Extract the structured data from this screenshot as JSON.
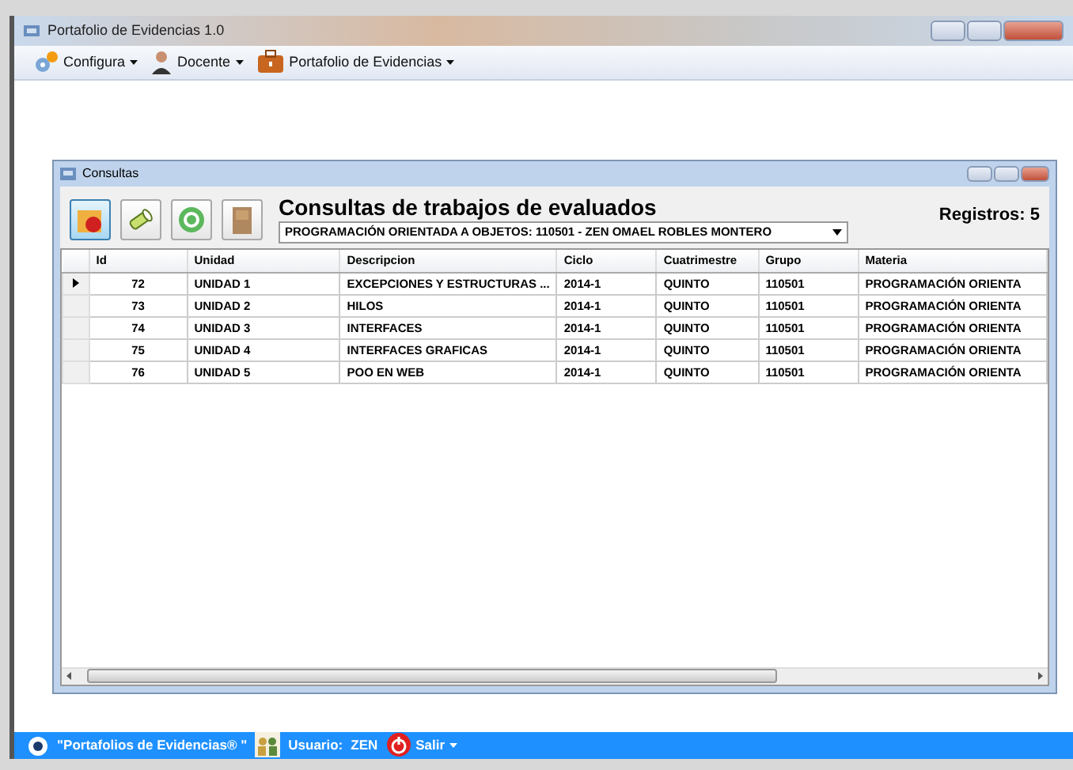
{
  "window": {
    "title": "Portafolio de Evidencias 1.0"
  },
  "menu": [
    {
      "label": "Configura"
    },
    {
      "label": "Docente"
    },
    {
      "label": "Portafolio de Evidencias"
    }
  ],
  "child_window": {
    "title": "Consultas",
    "heading": "Consultas de trabajos de evaluados",
    "records": "Registros: 5",
    "selector": {
      "value": "PROGRAMACIÓN ORIENTADA A OBJETOS: 110501 - ZEN OMAEL ROBLES MONTERO"
    }
  },
  "table": {
    "columns": [
      "Id",
      "Unidad",
      "Descripcion",
      "Ciclo",
      "Cuatrimestre",
      "Grupo",
      "Materia"
    ],
    "rows": [
      {
        "selected": true,
        "cells": [
          "72",
          "UNIDAD 1",
          "EXCEPCIONES Y ESTRUCTURAS ...",
          "2014-1",
          "QUINTO",
          "110501",
          "PROGRAMACIÓN ORIENTA"
        ]
      },
      {
        "selected": false,
        "cells": [
          "73",
          "UNIDAD 2",
          "HILOS",
          "2014-1",
          "QUINTO",
          "110501",
          "PROGRAMACIÓN ORIENTA"
        ]
      },
      {
        "selected": false,
        "cells": [
          "74",
          "UNIDAD 3",
          "INTERFACES",
          "2014-1",
          "QUINTO",
          "110501",
          "PROGRAMACIÓN ORIENTA"
        ]
      },
      {
        "selected": false,
        "cells": [
          "75",
          "UNIDAD 4",
          "INTERFACES GRAFICAS",
          "2014-1",
          "QUINTO",
          "110501",
          "PROGRAMACIÓN ORIENTA"
        ]
      },
      {
        "selected": false,
        "cells": [
          "76",
          "UNIDAD 5",
          "POO EN WEB",
          "2014-1",
          "QUINTO",
          "110501",
          "PROGRAMACIÓN ORIENTA"
        ]
      }
    ]
  },
  "status_bar": {
    "app": "\"Portafolios de Evidencias® \"",
    "user_label": "Usuario:",
    "user": "ZEN",
    "exit": "Salir"
  }
}
